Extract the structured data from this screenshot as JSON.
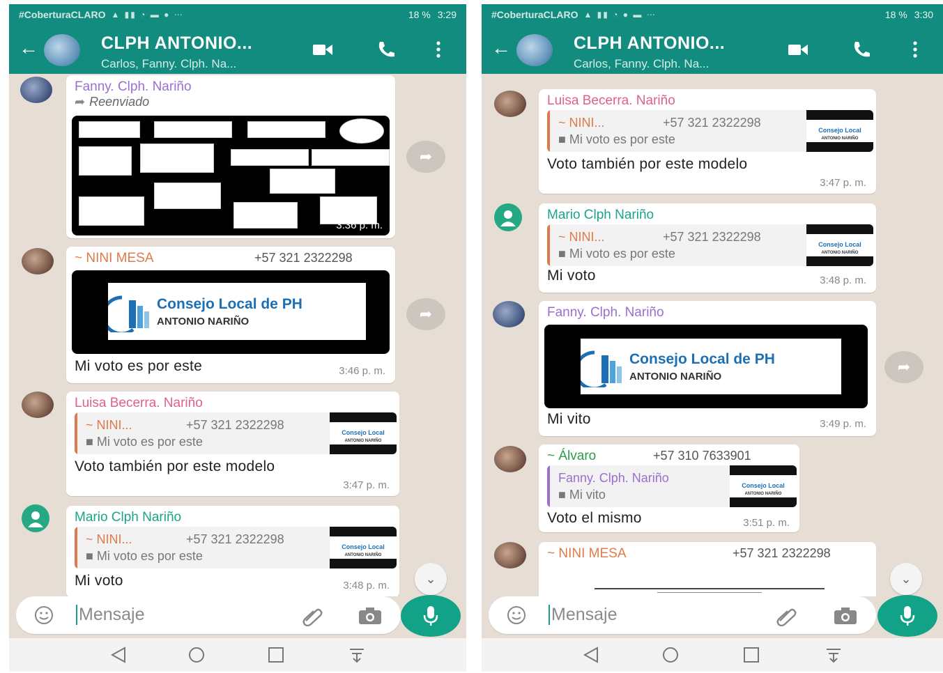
{
  "status_bar": {
    "carrier": "#CoberturaCLARO",
    "battery": "18 %"
  },
  "header": {
    "back_icon": "arrow-left-icon",
    "title": "CLPH ANTONIO...",
    "subtitle": "Carlos, Fanny. Clph. Na..."
  },
  "composer": {
    "placeholder": "Mensaje"
  },
  "logo": {
    "line1": "Consejo Local de PH",
    "line2": "ANTONIO NARIÑO",
    "thumb_line1": "Consejo Local",
    "thumb_line2": "ANTONIO NARIÑO"
  },
  "colors": {
    "header": "#128c7e",
    "accent": "#12a287",
    "chat_bg": "#e6ddd4",
    "fanny": "#9b6fcf",
    "nini": "#e07a4a",
    "luisa": "#e0608c",
    "mario": "#1aa58a",
    "alvaro": "#2a9d49"
  },
  "left": {
    "status_time": "3:29",
    "messages": [
      {
        "sender": "Fanny. Clph. Nariño",
        "forwarded": "Reenviado",
        "time": "3:36 p. m."
      },
      {
        "sender": "~ NINI MESA",
        "phone": "+57 321 2322298",
        "text": "Mi voto es por este",
        "time": "3:46 p. m."
      },
      {
        "sender": "Luisa Becerra. Nariño",
        "quote_sender": "~ NINI...",
        "quote_phone": "+57 321 2322298",
        "quote_text": "Mi voto es por este",
        "text": "Voto también por este modelo",
        "time": "3:47 p. m."
      },
      {
        "sender": "Mario Clph Nariño",
        "quote_sender": "~ NINI...",
        "quote_phone": "+57 321 2322298",
        "quote_text": "Mi voto es por este",
        "text": "Mi voto",
        "time": "3:48 p. m."
      }
    ]
  },
  "right": {
    "status_time": "3:30",
    "messages": [
      {
        "sender": "Luisa Becerra. Nariño",
        "quote_sender": "~ NINI...",
        "quote_phone": "+57 321 2322298",
        "quote_text": "Mi voto es por este",
        "text": "Voto también por este modelo",
        "time": "3:47 p. m."
      },
      {
        "sender": "Mario Clph Nariño",
        "quote_sender": "~ NINI...",
        "quote_phone": "+57 321 2322298",
        "quote_text": "Mi voto es por este",
        "text": "Mi voto",
        "time": "3:48 p. m."
      },
      {
        "sender": "Fanny. Clph. Nariño",
        "text": "Mi vito",
        "time": "3:49 p. m."
      },
      {
        "sender": "~ Álvaro",
        "phone": "+57 310 7633901",
        "quote_sender": "Fanny. Clph. Nariño",
        "quote_text": "Mi vito",
        "text": "Voto el mismo",
        "time": "3:51 p. m."
      },
      {
        "sender": "~ NINI MESA",
        "phone": "+57 321 2322298"
      }
    ]
  }
}
